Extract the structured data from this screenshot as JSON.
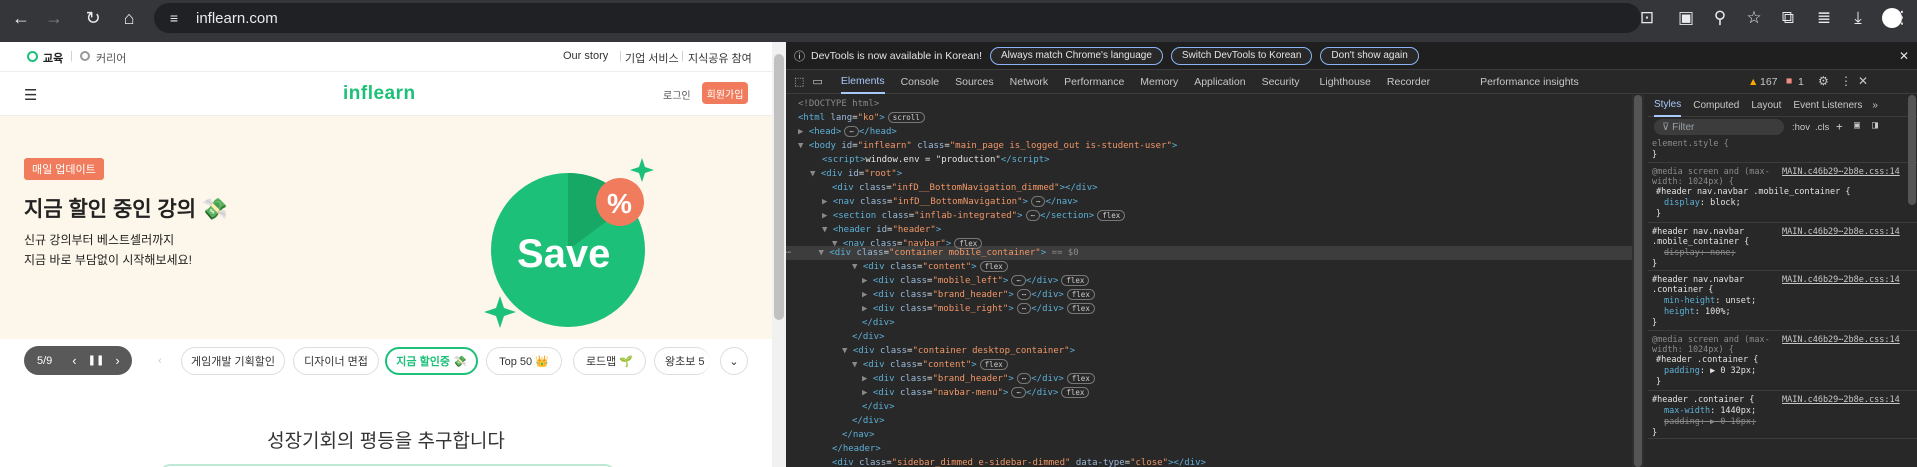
{
  "browser": {
    "url": "inflearn.com"
  },
  "page": {
    "topbar": {
      "edu": "교육",
      "career": "커리어",
      "our_story": "Our story",
      "enterprise": "기업 서비스",
      "knowledge": "지식공유 참여"
    },
    "gnb": {
      "logo": "inflearn",
      "login": "로그인",
      "signup": "회원가입"
    },
    "hero": {
      "badge": "매일 업데이트",
      "title": "지금 할인 중인 강의 💸",
      "desc1": "신규 강의부터 베스트셀러까지",
      "desc2": "지금 바로 부담없이 시작해보세요!",
      "save": "Save",
      "percent": "%"
    },
    "carousel": {
      "pager": "5/9",
      "chips": [
        "게임개발 기획할인",
        "디자이너 면접",
        "지금 할인중 💸",
        "Top 50 👑",
        "로드맵 🌱",
        "왕초보 5"
      ]
    },
    "slogan": "성장기회의 평등을 추구합니다"
  },
  "devtools": {
    "infobar": {
      "text": "DevTools is now available in Korean!",
      "btn1": "Always match Chrome's language",
      "btn2": "Switch DevTools to Korean",
      "btn3": "Don't show again"
    },
    "tabs": [
      "Elements",
      "Console",
      "Sources",
      "Network",
      "Performance",
      "Memory",
      "Application",
      "Security",
      "Lighthouse",
      "Recorder",
      "Performance insights"
    ],
    "warnings": "167",
    "errors": "1",
    "styles_tabs": [
      "Styles",
      "Computed",
      "Layout",
      "Event Listeners"
    ],
    "filter_placeholder": "Filter",
    "hov": ":hov",
    "cls": ".cls",
    "src": "MAIN.c46b29⋯2b8e.css:14"
  }
}
